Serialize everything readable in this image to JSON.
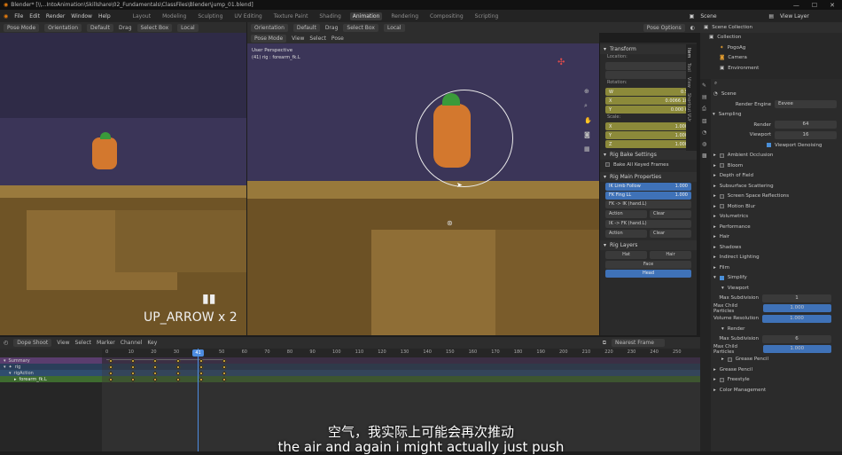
{
  "titlebar": {
    "title": "Blender* [\\\\...IntoAnimation\\Skillshare\\02_Fundamentals\\ClassFiles\\Blender\\jump_01.blend]"
  },
  "menubar": {
    "menus": [
      "File",
      "Edit",
      "Render",
      "Window",
      "Help"
    ],
    "workspaces": [
      "Layout",
      "Modeling",
      "Sculpting",
      "UV Editing",
      "Texture Paint",
      "Shading",
      "Animation",
      "Rendering",
      "Compositing",
      "Scripting"
    ],
    "active_workspace": "Animation",
    "scene": "Scene",
    "view_layer": "View Layer"
  },
  "left_viewport": {
    "mode": "Pose Mode",
    "orientation": "Orientation",
    "pivot": "Default",
    "drag": "Drag",
    "select": "Select Box",
    "transform": "Local",
    "overlay_text": "UP_ARROW x 2"
  },
  "right_viewport": {
    "mode": "Pose Mode",
    "menus": [
      "View",
      "Select",
      "Pose"
    ],
    "orientation": "Orientation",
    "pivot": "Default",
    "drag": "Drag",
    "select": "Select Box",
    "transform": "Local",
    "pose_options": "Pose Options",
    "info_line1": "User Perspective",
    "info_line2": "(41) rig : forearm_fk.L"
  },
  "npanel": {
    "tabs": [
      "Item",
      "Tool",
      "View",
      "Shortcut VUr"
    ],
    "transform_title": "Transform",
    "location_label": "Location:",
    "rotation_label": "Rotation:",
    "rotation": [
      {
        "axis": "W",
        "value": "0.5"
      },
      {
        "axis": "X",
        "value": "0.0066 18"
      },
      {
        "axis": "Y",
        "value": "0.000 0"
      },
      {
        "axis": "Z",
        "value": ""
      }
    ],
    "scale_label": "Scale:",
    "scale": [
      {
        "axis": "X",
        "value": "1.000"
      },
      {
        "axis": "Y",
        "value": "1.000"
      },
      {
        "axis": "Z",
        "value": "1.000"
      }
    ],
    "rig_bake_title": "Rig Bake Settings",
    "bake_all": "Bake All Keyed Frames",
    "rig_main_title": "Rig Main Properties",
    "ik_fk": [
      {
        "label": "IK Limb Follow",
        "value": "1.000"
      },
      {
        "label": "FK Fing LL",
        "value": "1.000"
      }
    ],
    "fk_ik_label": "FK -> IK (hand.L)",
    "ik_fk_label": "IK -> FK (hand.L)",
    "action_label": "Action",
    "clear_label": "Clear",
    "rig_layers_title": "Rig Layers",
    "layers": [
      "Hat",
      "Hair",
      "Face",
      "Head"
    ]
  },
  "outliner": {
    "title": "Scene Collection",
    "items": [
      "Collection",
      "PogoAg",
      "Camera",
      "Environment"
    ]
  },
  "properties": {
    "scene_label": "Scene",
    "render_engine_label": "Render Engine",
    "render_engine": "Eevee",
    "sampling_title": "Sampling",
    "render_label": "Render",
    "render_value": "64",
    "viewport_label": "Viewport",
    "viewport_value": "16",
    "viewport_denoising": "Viewport Denoising",
    "sections": [
      "Ambient Occlusion",
      "Bloom",
      "Depth of Field",
      "Subsurface Scattering",
      "Screen Space Reflections",
      "Motion Blur",
      "Volumetrics",
      "Performance",
      "Hair",
      "Shadows",
      "Indirect Lighting",
      "Film"
    ],
    "simplify": "Simplify",
    "viewport_sub": "Viewport",
    "max_subdiv_label": "Max Subdivision",
    "max_subdiv_value": "1",
    "max_child_label": "Max Child Particles",
    "max_child_value": "1.000",
    "volume_res_label": "Volume Resolution",
    "volume_res_value": "1.000",
    "render_sub": "Render",
    "r_max_subdiv_value": "6",
    "r_max_child_value": "1.000",
    "grease_pencil_cb": "Grease Pencil",
    "bottom_sections": [
      "Grease Pencil",
      "Freestyle",
      "Color Management"
    ]
  },
  "dopesheet": {
    "mode": "Dope Shoot",
    "menus": [
      "View",
      "Select",
      "Marker",
      "Channel",
      "Key"
    ],
    "snap": "Nearest Frame",
    "ruler": [
      "0",
      "10",
      "20",
      "30",
      "41",
      "50",
      "60",
      "70",
      "80",
      "90",
      "100",
      "110",
      "120",
      "130",
      "140",
      "150",
      "160",
      "170",
      "180",
      "190",
      "200",
      "210",
      "220",
      "230",
      "240",
      "250"
    ],
    "current_frame": "41",
    "channels": [
      "Summary",
      "rig",
      "rigAction",
      "forearm_fk.L"
    ]
  },
  "subtitles": {
    "zh": "空气，我实际上可能会再次推动",
    "en": "the air and again i might actually just push"
  },
  "colors": {
    "accent": "#4d8ce0",
    "viewport_bg": "#3b3558",
    "yellow_field": "#8c8a3a",
    "blue_field": "#3f72b8",
    "keyframe": "#e7b83a",
    "active_tab": "#3b3b3b"
  }
}
